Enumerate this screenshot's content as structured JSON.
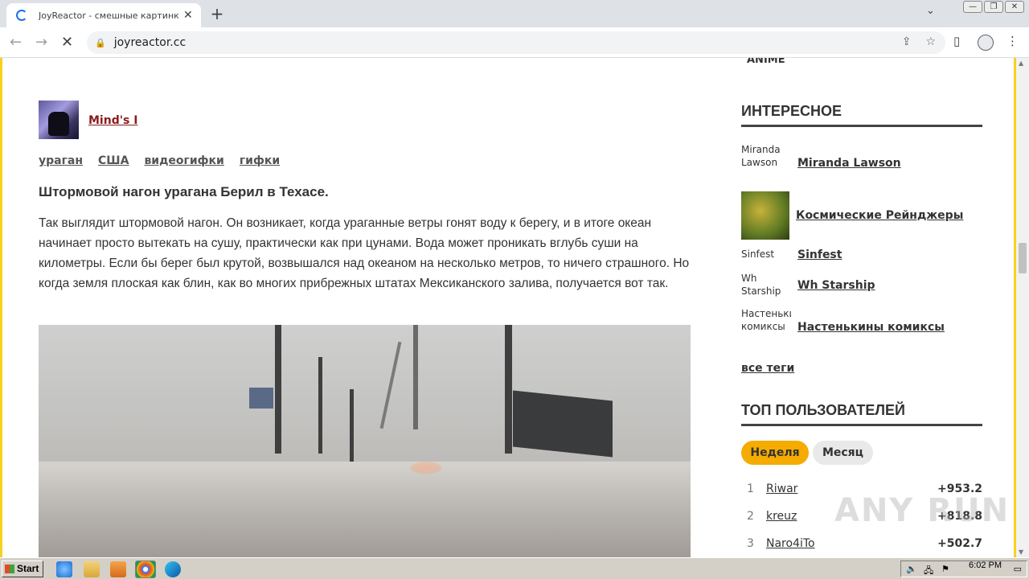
{
  "browser": {
    "tab_title": "JoyReactor - смешные картинки и",
    "tab_close": "✕",
    "new_tab": "+",
    "url": "joyreactor.cc",
    "window_controls": [
      "—",
      "❐",
      "✕"
    ]
  },
  "post": {
    "author": "Mind's I",
    "tags": [
      "ураган",
      "США",
      "видеогифки",
      "гифки"
    ],
    "title": "Штормовой нагон урагана Берил в Техасе.",
    "body": "Так выглядит штормовой нагон. Он возникает, когда ураганные ветры гонят воду к берегу, и в итоге океан начинает просто вытекать на сушу, практически как при цунами. Вода может проникать вглубь суши на километры. Если бы берег был крутой, возвышался над океаном на несколько метров, то ничего страшного. Но когда земля плоская как блин, как во многих прибрежных штатах Мексиканского залива, получается вот так."
  },
  "sidebar": {
    "anime": "ANIME",
    "interesting_heading": "ИНТЕРЕСНОЕ",
    "interesting": [
      {
        "thumb_alt": "Miranda Lawson",
        "label": "Miranda Lawson"
      },
      {
        "thumb_alt": "",
        "label": "Космические Рейнджеры"
      },
      {
        "thumb_alt": "Sinfest",
        "label": "Sinfest"
      },
      {
        "thumb_alt": "Wh Starship",
        "label": "Wh Starship"
      },
      {
        "thumb_alt": "Настенькины комиксы",
        "label": "Настенькины комиксы"
      }
    ],
    "all_tags": "все теги",
    "top_users_heading": "ТОП ПОЛЬЗОВАТЕЛЕЙ",
    "period_tabs": [
      "Неделя",
      "Месяц"
    ],
    "users": [
      {
        "rank": "1",
        "name": "Riwar",
        "score": "+953.2"
      },
      {
        "rank": "2",
        "name": "kreuz",
        "score": "+818.8"
      },
      {
        "rank": "3",
        "name": "Naro4iTo",
        "score": "+502.7"
      }
    ]
  },
  "watermark": "ANY RUN",
  "taskbar": {
    "start": "Start",
    "clock": "6:02 PM"
  }
}
